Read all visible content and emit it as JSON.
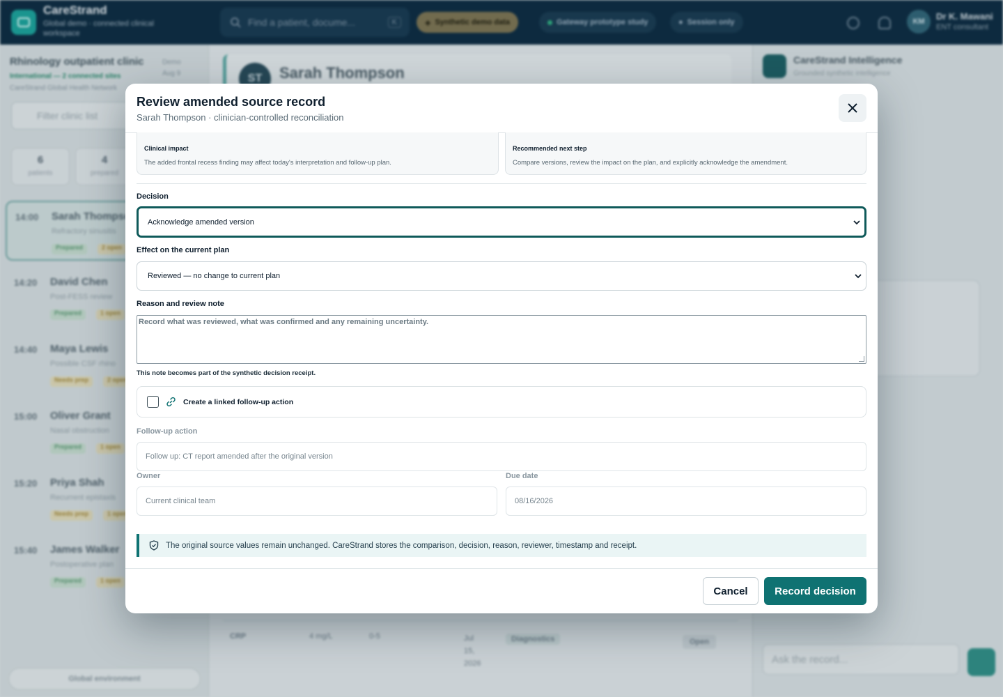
{
  "app": {
    "name": "CareStrand",
    "subtitle": "Global demo · connected clinical workspace",
    "search_placeholder": "Find a patient, docume...",
    "search_shortcut": "K",
    "pills": [
      "Synthetic demo data",
      "Gateway prototype study",
      "Session only"
    ],
    "user": {
      "initials": "KM",
      "name": "Dr K. Mawani",
      "role": "ENT consultant"
    }
  },
  "clinic": {
    "title": "Rhinology outpatient clinic",
    "subtitle": "International — 2 connected sites",
    "org": "CareStrand Global Health Network",
    "date_label": "Demo",
    "date": "Aug 9",
    "filter_placeholder": "Filter clinic list",
    "stats": [
      {
        "value": "6",
        "label": "patients"
      },
      {
        "value": "4",
        "label": "prepared"
      }
    ],
    "patients": [
      {
        "time": "14:00",
        "name": "Sarah Thompson",
        "desc": "Refractory sinusitis",
        "tags": [
          "Prepared",
          "2 open"
        ]
      },
      {
        "time": "14:20",
        "name": "David Chen",
        "desc": "Post-FESS review",
        "tags": [
          "Prepared",
          "1 open"
        ]
      },
      {
        "time": "14:40",
        "name": "Maya Lewis",
        "desc": "Possible CSF rhino",
        "tags": [
          "Needs prep",
          "2 open"
        ]
      },
      {
        "time": "15:00",
        "name": "Oliver Grant",
        "desc": "Nasal obstruction",
        "tags": [
          "Prepared",
          "1 open"
        ]
      },
      {
        "time": "15:20",
        "name": "Priya Shah",
        "desc": "Recurrent epistaxis",
        "tags": [
          "Needs prep",
          "1 open"
        ]
      },
      {
        "time": "15:40",
        "name": "James Walker",
        "desc": "Postoperative plan",
        "tags": [
          "Prepared",
          "1 open"
        ]
      }
    ],
    "env_label": "Global environment"
  },
  "center": {
    "patient_initials": "ST",
    "patient_name": "Sarah Thompson",
    "crp": {
      "name": "CRP",
      "value": "4 mg/L",
      "range": "0-5",
      "date": "Jul 15, 2026",
      "tag": "Diagnostics",
      "open_label": "Open"
    }
  },
  "assistant": {
    "title": "CareStrand Intelligence",
    "subtitle": "Grounded synthetic intelligence",
    "ask_placeholder": "Ask the record..."
  },
  "modal": {
    "title": "Review amended source record",
    "subtitle": "Sarah Thompson · clinician-controlled reconciliation",
    "impact": {
      "title": "Clinical impact",
      "text": "The added frontal recess finding may affect today's interpretation and follow-up plan."
    },
    "next_step": {
      "title": "Recommended next step",
      "text": "Compare versions, review the impact on the plan, and explicitly acknowledge the amendment."
    },
    "decision": {
      "label": "Decision",
      "value": "Acknowledge amended version"
    },
    "effect": {
      "label": "Effect on the current plan",
      "value": "Reviewed — no change to current plan"
    },
    "reason": {
      "label": "Reason and review note",
      "placeholder": "Record what was reviewed, what was confirmed and any remaining uncertainty.",
      "hint": "This note becomes part of the synthetic decision receipt."
    },
    "followup_check": {
      "label": "Create a linked follow-up action",
      "checked": false
    },
    "followup": {
      "label": "Follow-up action",
      "value": "Follow up: CT report amended after the original version"
    },
    "owner": {
      "label": "Owner",
      "value": "Current clinical team"
    },
    "due": {
      "label": "Due date",
      "value": "08/16/2026"
    },
    "note": "The original source values remain unchanged. CareStrand stores the comparison, decision, reason, reviewer, timestamp and receipt.",
    "cancel_label": "Cancel",
    "record_label": "Record decision",
    "colors": {
      "accent": "#0f7272",
      "focus": "#0f5a5a"
    }
  }
}
